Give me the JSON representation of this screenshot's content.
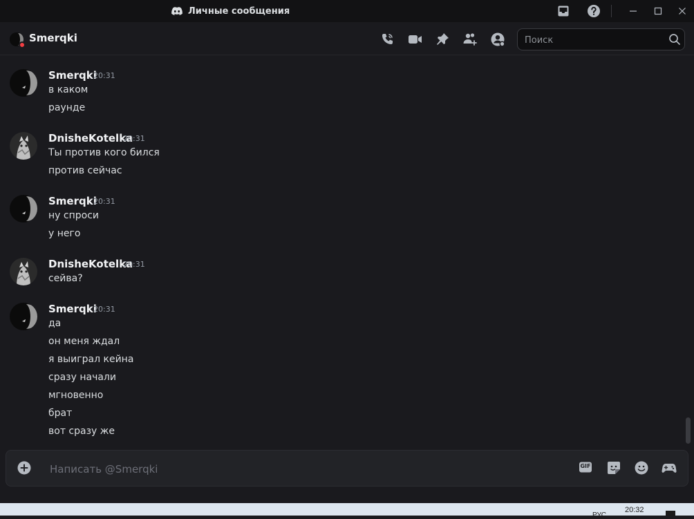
{
  "window": {
    "title": "Личные сообщения"
  },
  "channel": {
    "name": "Smerqki",
    "search_placeholder": "Поиск"
  },
  "messages": [
    {
      "author": "Smerqki",
      "time": "20:31",
      "lines": [
        "в каком",
        "раунде"
      ]
    },
    {
      "author": "DnisheKotelka",
      "time": "20:31",
      "lines": [
        "Ты против кого бился",
        "против сейчас"
      ]
    },
    {
      "author": "Smerqki",
      "time": "20:31",
      "lines": [
        "ну спроси",
        "у него"
      ]
    },
    {
      "author": "DnisheKotelka",
      "time": "20:31",
      "lines": [
        "сейва?"
      ]
    },
    {
      "author": "Smerqki",
      "time": "20:31",
      "lines": [
        "да",
        "он меня ждал",
        "я выиграл кейна",
        "сразу начали",
        "мгновенно",
        "брат",
        "вот сразу же"
      ]
    }
  ],
  "composer": {
    "placeholder": "Написать @Smerqki",
    "gif_label": "GIF"
  },
  "taskbar": {
    "time": "20:32",
    "lang": "РУС"
  },
  "colors": {
    "background": "#1a1a1e",
    "titlebar": "#121214",
    "dnd_status": "#f23f43"
  }
}
